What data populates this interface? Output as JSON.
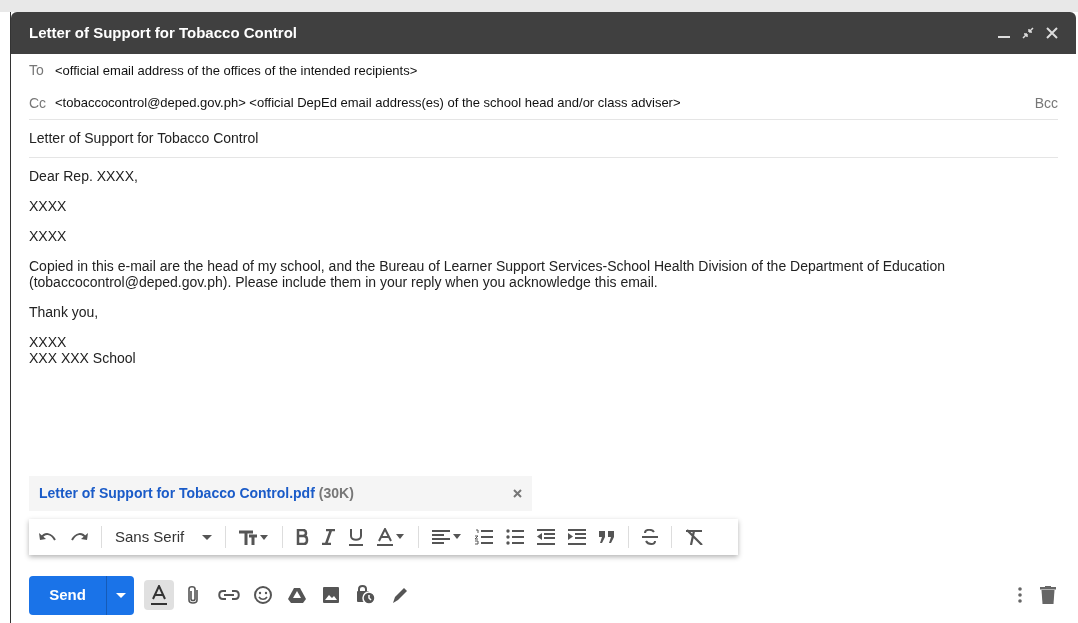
{
  "window": {
    "title": "Letter of Support for Tobacco Control"
  },
  "recipients": [
    {
      "label": "To",
      "value": "<official email address of the offices of the intended recipients>"
    },
    {
      "label": "Cc",
      "value": "<tobaccocontrol@deped.gov.ph> <official DepEd email address(es) of the school head and/or class adviser>",
      "extra": "Bcc"
    }
  ],
  "subject": "Letter of Support for Tobacco Control",
  "body": [
    [
      "Dear Rep. XXXX,"
    ],
    [
      "XXXX"
    ],
    [
      "XXXX"
    ],
    [
      "Copied in this e-mail are the head of my school, and the Bureau of Learner Support Services-School Health Division of the Department of Education",
      "(tobaccocontrol@deped.gov.ph). Please include them in your reply when you acknowledge this email."
    ],
    [
      "Thank you,"
    ],
    [
      "XXXX",
      "XXX XXX School"
    ]
  ],
  "attachment": {
    "name": "Letter of Support for Tobacco Control.pdf",
    "size": "(30K)"
  },
  "format_toolbar": {
    "font": "Sans Serif"
  },
  "send": {
    "label": "Send"
  },
  "formatting_toggle": {
    "selected": true
  }
}
